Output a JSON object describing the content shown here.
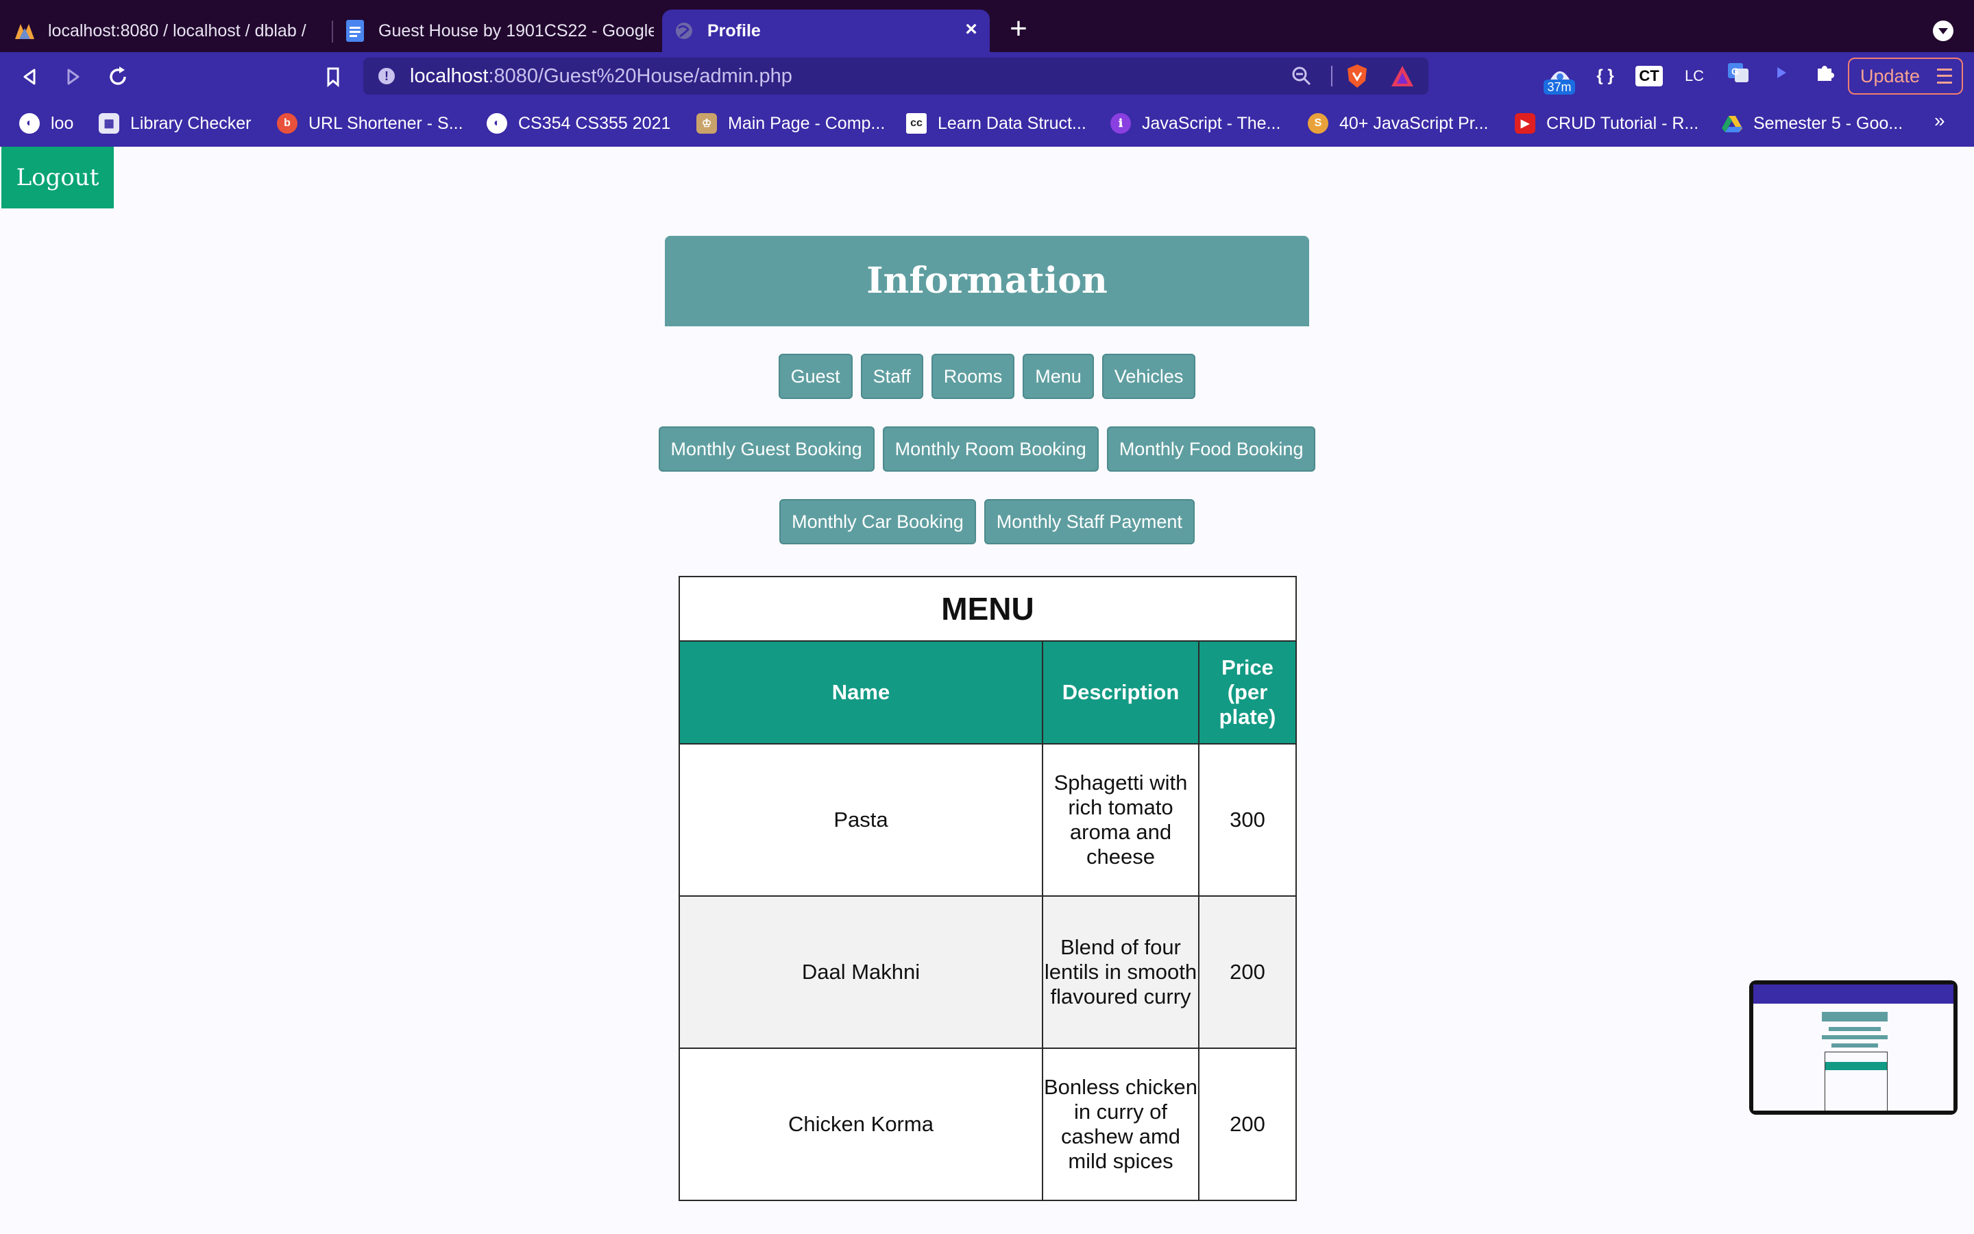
{
  "browser": {
    "tabs": [
      {
        "title": "localhost:8080 / localhost / dblab /",
        "active": false
      },
      {
        "title": "Guest House by 1901CS22 - Google",
        "active": false
      },
      {
        "title": "Profile",
        "active": true
      }
    ],
    "url": {
      "host": "localhost",
      "path": ":8080/Guest%20House/admin.php"
    },
    "extension_badge": "37m",
    "extensions": [
      "{ }",
      "CT",
      "LC"
    ],
    "update_label": "Update",
    "bookmarks": [
      "loo",
      "Library Checker",
      "URL Shortener - S...",
      "CS354 CS355 2021",
      "Main Page - Comp...",
      "Learn Data Struct...",
      "JavaScript - The...",
      "40+ JavaScript Pr...",
      "CRUD Tutorial - R...",
      "Semester 5 - Goo..."
    ],
    "bookmarks_more": "»"
  },
  "page": {
    "logout_label": "Logout",
    "header_title": "Information",
    "nav_row1": [
      "Guest",
      "Staff",
      "Rooms",
      "Menu",
      "Vehicles"
    ],
    "nav_row2": [
      "Monthly Guest Booking",
      "Monthly Room Booking",
      "Monthly Food Booking"
    ],
    "nav_row3": [
      "Monthly Car Booking",
      "Monthly Staff Payment"
    ],
    "accent_color": "#5f9ea0",
    "header_teal": "#139a84",
    "logout_color": "#0aa475"
  },
  "menu_table": {
    "caption": "MENU",
    "headers": [
      "Name",
      "Description",
      "Price (per plate)"
    ],
    "rows": [
      {
        "name": "Pasta",
        "description": "Sphagetti with rich tomato aroma and cheese",
        "price": "300"
      },
      {
        "name": "Daal Makhni",
        "description": "Blend of four lentils in smooth flavoured curry",
        "price": "200"
      },
      {
        "name": "Chicken Korma",
        "description": "Bonless chicken in curry of cashew amd mild spices",
        "price": "200"
      }
    ]
  }
}
